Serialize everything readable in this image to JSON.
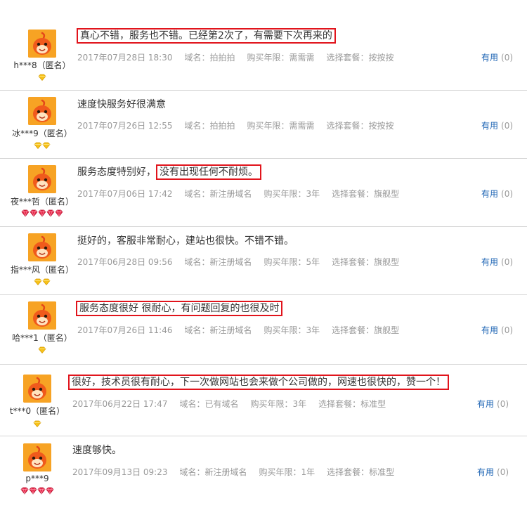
{
  "reviews": [
    {
      "user": "h***8（匿名）",
      "badge": "yellow",
      "badge_count": 1,
      "content_before": "",
      "content_highlight": "真心不错，服务也不错。已经第2次了，有需要下次再来的",
      "content_after": "",
      "date": "2017年07月28日 18:30",
      "domain": "域名：拍拍拍",
      "years": "购买年限：需需需",
      "package": "选择套餐：按按按",
      "useful_label": "有用",
      "useful_count": "(0)"
    },
    {
      "user": "冰***9（匿名）",
      "badge": "yellow",
      "badge_count": 2,
      "content_before": "速度快服务好很满意",
      "content_highlight": "",
      "content_after": "",
      "date": "2017年07月26日 12:55",
      "domain": "域名：拍拍拍",
      "years": "购买年限：需需需",
      "package": "选择套餐：按按按",
      "useful_label": "有用",
      "useful_count": "(0)"
    },
    {
      "user": "夜***哲（匿名）",
      "badge": "red",
      "badge_count": 5,
      "content_before": "服务态度特别好，",
      "content_highlight": "没有出现任何不耐烦。",
      "content_after": "",
      "date": "2017年07月06日 17:42",
      "domain": "域名：新注册域名",
      "years": "购买年限：3年",
      "package": "选择套餐：旗舰型",
      "useful_label": "有用",
      "useful_count": "(0)"
    },
    {
      "user": "指***风（匿名）",
      "badge": "yellow",
      "badge_count": 2,
      "content_before": "挺好的，客服非常耐心，建站也很快。不错不错。",
      "content_highlight": "",
      "content_after": "",
      "date": "2017年06月28日 09:56",
      "domain": "域名：新注册域名",
      "years": "购买年限：5年",
      "package": "选择套餐：旗舰型",
      "useful_label": "有用",
      "useful_count": "(0)"
    },
    {
      "user": "哈***1（匿名）",
      "badge": "yellow",
      "badge_count": 1,
      "content_before": "",
      "content_highlight": "服务态度很好 很耐心，有问题回复的也很及时",
      "content_after": "",
      "date": "2017年07月26日 11:46",
      "domain": "域名：新注册域名",
      "years": "购买年限：3年",
      "package": "选择套餐：旗舰型",
      "useful_label": "有用",
      "useful_count": "(0)"
    },
    {
      "user": "t***0（匿名）",
      "badge": "yellow",
      "badge_count": 1,
      "content_before": "",
      "content_highlight": "很好，技术员很有耐心，下一次做网站也会来做个公司做的，网速也很快的，赞一个！",
      "content_after": "",
      "date": "2017年06月22日 17:47",
      "domain": "域名：已有域名",
      "years": "购买年限：3年",
      "package": "选择套餐：标准型",
      "useful_label": "有用",
      "useful_count": "(0)"
    },
    {
      "user": "p***9",
      "badge": "red",
      "badge_count": 4,
      "content_before": "速度够快。",
      "content_highlight": "",
      "content_after": "",
      "date": "2017年09月13日 09:23",
      "domain": "域名：新注册域名",
      "years": "购买年限：1年",
      "package": "选择套餐：标准型",
      "useful_label": "有用",
      "useful_count": "(0)"
    }
  ],
  "colors": {
    "highlight_border": "#e1141c",
    "useful_link": "#1d64b4",
    "avatar_bg": "#f7a324",
    "meta_text": "#999999"
  }
}
